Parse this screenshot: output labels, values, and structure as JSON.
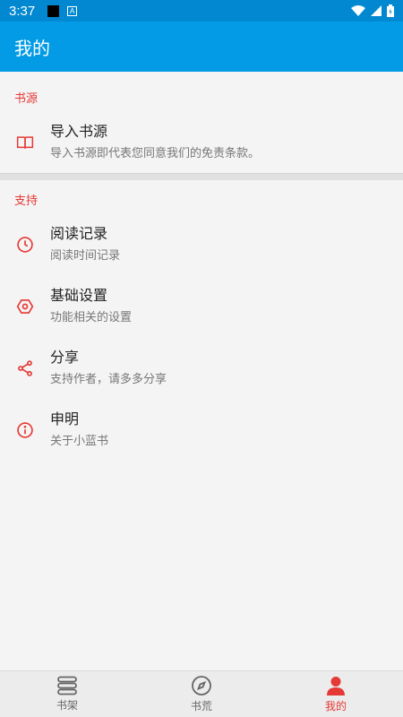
{
  "status_bar": {
    "time": "3:37",
    "notif_letter": "A"
  },
  "app_bar": {
    "title": "我的"
  },
  "sections": [
    {
      "title": "书源",
      "items": [
        {
          "icon": "book-open-icon",
          "title": "导入书源",
          "subtitle": "导入书源即代表您同意我们的免责条款。"
        }
      ]
    },
    {
      "title": "支持",
      "items": [
        {
          "icon": "clock-icon",
          "title": "阅读记录",
          "subtitle": "阅读时间记录"
        },
        {
          "icon": "hexagon-settings-icon",
          "title": "基础设置",
          "subtitle": "功能相关的设置"
        },
        {
          "icon": "share-icon",
          "title": "分享",
          "subtitle": "支持作者，请多多分享"
        },
        {
          "icon": "info-icon",
          "title": "申明",
          "subtitle": "关于小蓝书"
        }
      ]
    }
  ],
  "bottom_nav": [
    {
      "icon": "bookshelf-icon",
      "label": "书架",
      "active": false
    },
    {
      "icon": "compass-icon",
      "label": "书荒",
      "active": false
    },
    {
      "icon": "person-icon",
      "label": "我的",
      "active": true
    }
  ],
  "colors": {
    "primary": "#039be5",
    "status": "#0288d1",
    "accent": "#e53935"
  }
}
